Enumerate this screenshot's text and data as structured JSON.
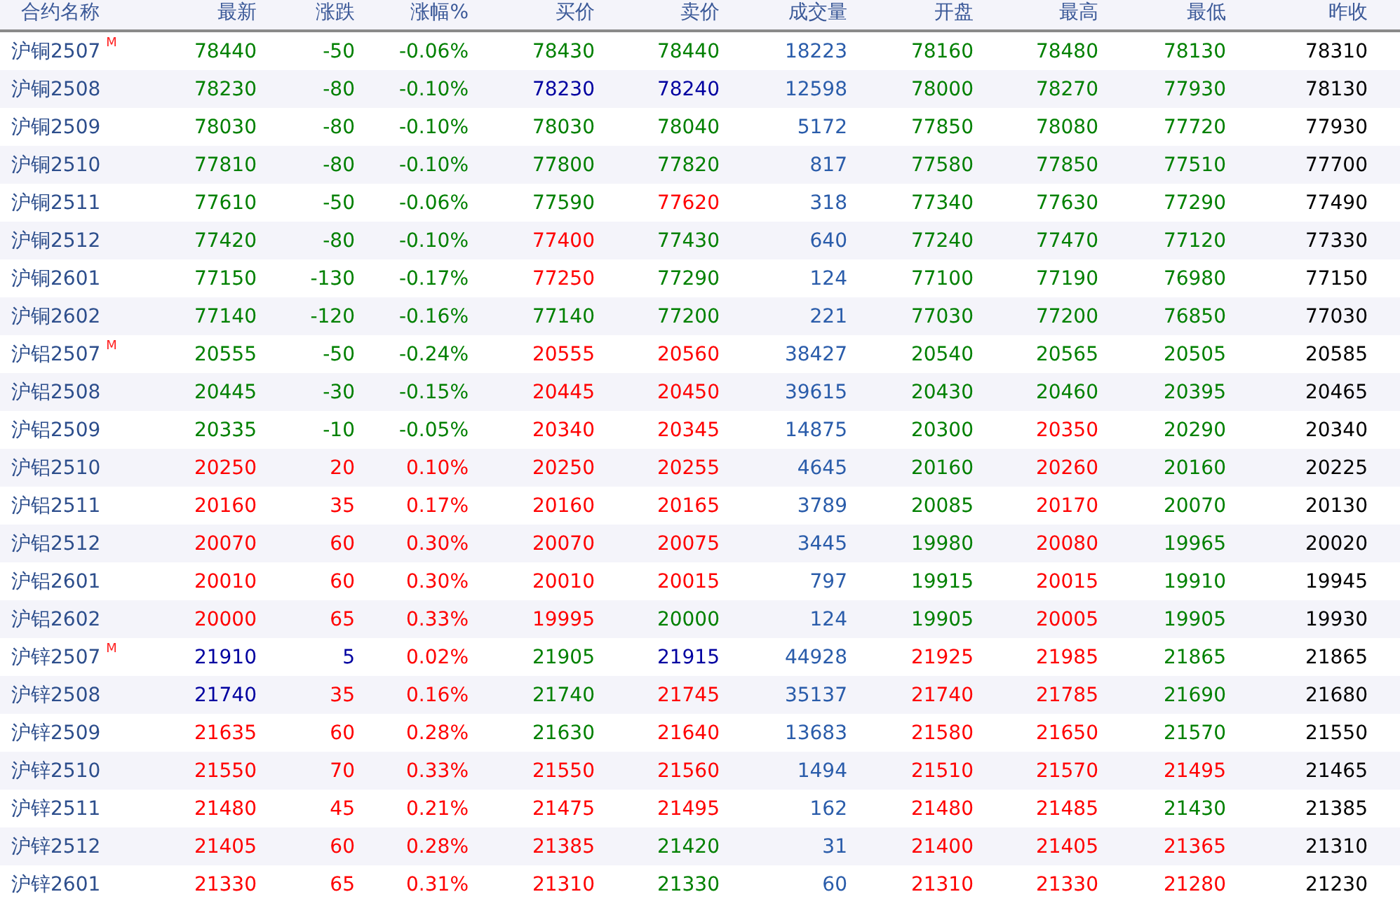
{
  "columns": [
    "合约名称",
    "最新",
    "涨跌",
    "涨幅%",
    "买价",
    "卖价",
    "成交量",
    "开盘",
    "最高",
    "最低",
    "昨收"
  ],
  "rows": [
    {
      "name": "沪铜2507",
      "badge": "M",
      "cells": [
        {
          "text": "78440",
          "color": "#008000"
        },
        {
          "text": "-50",
          "color": "#008000"
        },
        {
          "text": "-0.06%",
          "color": "#008000"
        },
        {
          "text": "78430",
          "color": "#008000"
        },
        {
          "text": "78440",
          "color": "#008000"
        },
        {
          "text": "18223",
          "color": "#2a5caa"
        },
        {
          "text": "78160",
          "color": "#008000"
        },
        {
          "text": "78480",
          "color": "#008000"
        },
        {
          "text": "78130",
          "color": "#008000"
        },
        {
          "text": "78310",
          "color": "#000000"
        }
      ]
    },
    {
      "name": "沪铜2508",
      "cells": [
        {
          "text": "78230",
          "color": "#008000"
        },
        {
          "text": "-80",
          "color": "#008000"
        },
        {
          "text": "-0.10%",
          "color": "#008000"
        },
        {
          "text": "78230",
          "color": "#0000a0"
        },
        {
          "text": "78240",
          "color": "#0000a0"
        },
        {
          "text": "12598",
          "color": "#2a5caa"
        },
        {
          "text": "78000",
          "color": "#008000"
        },
        {
          "text": "78270",
          "color": "#008000"
        },
        {
          "text": "77930",
          "color": "#008000"
        },
        {
          "text": "78130",
          "color": "#000000"
        }
      ]
    },
    {
      "name": "沪铜2509",
      "cells": [
        {
          "text": "78030",
          "color": "#008000"
        },
        {
          "text": "-80",
          "color": "#008000"
        },
        {
          "text": "-0.10%",
          "color": "#008000"
        },
        {
          "text": "78030",
          "color": "#008000"
        },
        {
          "text": "78040",
          "color": "#008000"
        },
        {
          "text": "5172",
          "color": "#2a5caa"
        },
        {
          "text": "77850",
          "color": "#008000"
        },
        {
          "text": "78080",
          "color": "#008000"
        },
        {
          "text": "77720",
          "color": "#008000"
        },
        {
          "text": "77930",
          "color": "#000000"
        }
      ]
    },
    {
      "name": "沪铜2510",
      "cells": [
        {
          "text": "77810",
          "color": "#008000"
        },
        {
          "text": "-80",
          "color": "#008000"
        },
        {
          "text": "-0.10%",
          "color": "#008000"
        },
        {
          "text": "77800",
          "color": "#008000"
        },
        {
          "text": "77820",
          "color": "#008000"
        },
        {
          "text": "817",
          "color": "#2a5caa"
        },
        {
          "text": "77580",
          "color": "#008000"
        },
        {
          "text": "77850",
          "color": "#008000"
        },
        {
          "text": "77510",
          "color": "#008000"
        },
        {
          "text": "77700",
          "color": "#000000"
        }
      ]
    },
    {
      "name": "沪铜2511",
      "cells": [
        {
          "text": "77610",
          "color": "#008000"
        },
        {
          "text": "-50",
          "color": "#008000"
        },
        {
          "text": "-0.06%",
          "color": "#008000"
        },
        {
          "text": "77590",
          "color": "#008000"
        },
        {
          "text": "77620",
          "color": "#ff0000"
        },
        {
          "text": "318",
          "color": "#2a5caa"
        },
        {
          "text": "77340",
          "color": "#008000"
        },
        {
          "text": "77630",
          "color": "#008000"
        },
        {
          "text": "77290",
          "color": "#008000"
        },
        {
          "text": "77490",
          "color": "#000000"
        }
      ]
    },
    {
      "name": "沪铜2512",
      "cells": [
        {
          "text": "77420",
          "color": "#008000"
        },
        {
          "text": "-80",
          "color": "#008000"
        },
        {
          "text": "-0.10%",
          "color": "#008000"
        },
        {
          "text": "77400",
          "color": "#ff0000"
        },
        {
          "text": "77430",
          "color": "#008000"
        },
        {
          "text": "640",
          "color": "#2a5caa"
        },
        {
          "text": "77240",
          "color": "#008000"
        },
        {
          "text": "77470",
          "color": "#008000"
        },
        {
          "text": "77120",
          "color": "#008000"
        },
        {
          "text": "77330",
          "color": "#000000"
        }
      ]
    },
    {
      "name": "沪铜2601",
      "cells": [
        {
          "text": "77150",
          "color": "#008000"
        },
        {
          "text": "-130",
          "color": "#008000"
        },
        {
          "text": "-0.17%",
          "color": "#008000"
        },
        {
          "text": "77250",
          "color": "#ff0000"
        },
        {
          "text": "77290",
          "color": "#008000"
        },
        {
          "text": "124",
          "color": "#2a5caa"
        },
        {
          "text": "77100",
          "color": "#008000"
        },
        {
          "text": "77190",
          "color": "#008000"
        },
        {
          "text": "76980",
          "color": "#008000"
        },
        {
          "text": "77150",
          "color": "#000000"
        }
      ]
    },
    {
      "name": "沪铜2602",
      "cells": [
        {
          "text": "77140",
          "color": "#008000"
        },
        {
          "text": "-120",
          "color": "#008000"
        },
        {
          "text": "-0.16%",
          "color": "#008000"
        },
        {
          "text": "77140",
          "color": "#008000"
        },
        {
          "text": "77200",
          "color": "#008000"
        },
        {
          "text": "221",
          "color": "#2a5caa"
        },
        {
          "text": "77030",
          "color": "#008000"
        },
        {
          "text": "77200",
          "color": "#008000"
        },
        {
          "text": "76850",
          "color": "#008000"
        },
        {
          "text": "77030",
          "color": "#000000"
        }
      ]
    },
    {
      "name": "沪铝2507",
      "badge": "M",
      "cells": [
        {
          "text": "20555",
          "color": "#008000"
        },
        {
          "text": "-50",
          "color": "#008000"
        },
        {
          "text": "-0.24%",
          "color": "#008000"
        },
        {
          "text": "20555",
          "color": "#ff0000"
        },
        {
          "text": "20560",
          "color": "#ff0000"
        },
        {
          "text": "38427",
          "color": "#2a5caa"
        },
        {
          "text": "20540",
          "color": "#008000"
        },
        {
          "text": "20565",
          "color": "#008000"
        },
        {
          "text": "20505",
          "color": "#008000"
        },
        {
          "text": "20585",
          "color": "#000000"
        }
      ]
    },
    {
      "name": "沪铝2508",
      "cells": [
        {
          "text": "20445",
          "color": "#008000"
        },
        {
          "text": "-30",
          "color": "#008000"
        },
        {
          "text": "-0.15%",
          "color": "#008000"
        },
        {
          "text": "20445",
          "color": "#ff0000"
        },
        {
          "text": "20450",
          "color": "#ff0000"
        },
        {
          "text": "39615",
          "color": "#2a5caa"
        },
        {
          "text": "20430",
          "color": "#008000"
        },
        {
          "text": "20460",
          "color": "#008000"
        },
        {
          "text": "20395",
          "color": "#008000"
        },
        {
          "text": "20465",
          "color": "#000000"
        }
      ]
    },
    {
      "name": "沪铝2509",
      "cells": [
        {
          "text": "20335",
          "color": "#008000"
        },
        {
          "text": "-10",
          "color": "#008000"
        },
        {
          "text": "-0.05%",
          "color": "#008000"
        },
        {
          "text": "20340",
          "color": "#ff0000"
        },
        {
          "text": "20345",
          "color": "#ff0000"
        },
        {
          "text": "14875",
          "color": "#2a5caa"
        },
        {
          "text": "20300",
          "color": "#008000"
        },
        {
          "text": "20350",
          "color": "#ff0000"
        },
        {
          "text": "20290",
          "color": "#008000"
        },
        {
          "text": "20340",
          "color": "#000000"
        }
      ]
    },
    {
      "name": "沪铝2510",
      "cells": [
        {
          "text": "20250",
          "color": "#ff0000"
        },
        {
          "text": "20",
          "color": "#ff0000"
        },
        {
          "text": "0.10%",
          "color": "#ff0000"
        },
        {
          "text": "20250",
          "color": "#ff0000"
        },
        {
          "text": "20255",
          "color": "#ff0000"
        },
        {
          "text": "4645",
          "color": "#2a5caa"
        },
        {
          "text": "20160",
          "color": "#008000"
        },
        {
          "text": "20260",
          "color": "#ff0000"
        },
        {
          "text": "20160",
          "color": "#008000"
        },
        {
          "text": "20225",
          "color": "#000000"
        }
      ]
    },
    {
      "name": "沪铝2511",
      "cells": [
        {
          "text": "20160",
          "color": "#ff0000"
        },
        {
          "text": "35",
          "color": "#ff0000"
        },
        {
          "text": "0.17%",
          "color": "#ff0000"
        },
        {
          "text": "20160",
          "color": "#ff0000"
        },
        {
          "text": "20165",
          "color": "#ff0000"
        },
        {
          "text": "3789",
          "color": "#2a5caa"
        },
        {
          "text": "20085",
          "color": "#008000"
        },
        {
          "text": "20170",
          "color": "#ff0000"
        },
        {
          "text": "20070",
          "color": "#008000"
        },
        {
          "text": "20130",
          "color": "#000000"
        }
      ]
    },
    {
      "name": "沪铝2512",
      "cells": [
        {
          "text": "20070",
          "color": "#ff0000"
        },
        {
          "text": "60",
          "color": "#ff0000"
        },
        {
          "text": "0.30%",
          "color": "#ff0000"
        },
        {
          "text": "20070",
          "color": "#ff0000"
        },
        {
          "text": "20075",
          "color": "#ff0000"
        },
        {
          "text": "3445",
          "color": "#2a5caa"
        },
        {
          "text": "19980",
          "color": "#008000"
        },
        {
          "text": "20080",
          "color": "#ff0000"
        },
        {
          "text": "19965",
          "color": "#008000"
        },
        {
          "text": "20020",
          "color": "#000000"
        }
      ]
    },
    {
      "name": "沪铝2601",
      "cells": [
        {
          "text": "20010",
          "color": "#ff0000"
        },
        {
          "text": "60",
          "color": "#ff0000"
        },
        {
          "text": "0.30%",
          "color": "#ff0000"
        },
        {
          "text": "20010",
          "color": "#ff0000"
        },
        {
          "text": "20015",
          "color": "#ff0000"
        },
        {
          "text": "797",
          "color": "#2a5caa"
        },
        {
          "text": "19915",
          "color": "#008000"
        },
        {
          "text": "20015",
          "color": "#ff0000"
        },
        {
          "text": "19910",
          "color": "#008000"
        },
        {
          "text": "19945",
          "color": "#000000"
        }
      ]
    },
    {
      "name": "沪铝2602",
      "cells": [
        {
          "text": "20000",
          "color": "#ff0000"
        },
        {
          "text": "65",
          "color": "#ff0000"
        },
        {
          "text": "0.33%",
          "color": "#ff0000"
        },
        {
          "text": "19995",
          "color": "#ff0000"
        },
        {
          "text": "20000",
          "color": "#008000"
        },
        {
          "text": "124",
          "color": "#2a5caa"
        },
        {
          "text": "19905",
          "color": "#008000"
        },
        {
          "text": "20005",
          "color": "#ff0000"
        },
        {
          "text": "19905",
          "color": "#008000"
        },
        {
          "text": "19930",
          "color": "#000000"
        }
      ]
    },
    {
      "name": "沪锌2507",
      "badge": "M",
      "cells": [
        {
          "text": "21910",
          "color": "#0000a0"
        },
        {
          "text": "5",
          "color": "#0000a0"
        },
        {
          "text": "0.02%",
          "color": "#ff0000"
        },
        {
          "text": "21905",
          "color": "#008000"
        },
        {
          "text": "21915",
          "color": "#0000a0"
        },
        {
          "text": "44928",
          "color": "#2a5caa"
        },
        {
          "text": "21925",
          "color": "#ff0000"
        },
        {
          "text": "21985",
          "color": "#ff0000"
        },
        {
          "text": "21865",
          "color": "#008000"
        },
        {
          "text": "21865",
          "color": "#000000"
        }
      ]
    },
    {
      "name": "沪锌2508",
      "cells": [
        {
          "text": "21740",
          "color": "#0000a0"
        },
        {
          "text": "35",
          "color": "#ff0000"
        },
        {
          "text": "0.16%",
          "color": "#ff0000"
        },
        {
          "text": "21740",
          "color": "#008000"
        },
        {
          "text": "21745",
          "color": "#ff0000"
        },
        {
          "text": "35137",
          "color": "#2a5caa"
        },
        {
          "text": "21740",
          "color": "#ff0000"
        },
        {
          "text": "21785",
          "color": "#ff0000"
        },
        {
          "text": "21690",
          "color": "#008000"
        },
        {
          "text": "21680",
          "color": "#000000"
        }
      ]
    },
    {
      "name": "沪锌2509",
      "cells": [
        {
          "text": "21635",
          "color": "#ff0000"
        },
        {
          "text": "60",
          "color": "#ff0000"
        },
        {
          "text": "0.28%",
          "color": "#ff0000"
        },
        {
          "text": "21630",
          "color": "#008000"
        },
        {
          "text": "21640",
          "color": "#ff0000"
        },
        {
          "text": "13683",
          "color": "#2a5caa"
        },
        {
          "text": "21580",
          "color": "#ff0000"
        },
        {
          "text": "21650",
          "color": "#ff0000"
        },
        {
          "text": "21570",
          "color": "#008000"
        },
        {
          "text": "21550",
          "color": "#000000"
        }
      ]
    },
    {
      "name": "沪锌2510",
      "cells": [
        {
          "text": "21550",
          "color": "#ff0000"
        },
        {
          "text": "70",
          "color": "#ff0000"
        },
        {
          "text": "0.33%",
          "color": "#ff0000"
        },
        {
          "text": "21550",
          "color": "#ff0000"
        },
        {
          "text": "21560",
          "color": "#ff0000"
        },
        {
          "text": "1494",
          "color": "#2a5caa"
        },
        {
          "text": "21510",
          "color": "#ff0000"
        },
        {
          "text": "21570",
          "color": "#ff0000"
        },
        {
          "text": "21495",
          "color": "#ff0000"
        },
        {
          "text": "21465",
          "color": "#000000"
        }
      ]
    },
    {
      "name": "沪锌2511",
      "cells": [
        {
          "text": "21480",
          "color": "#ff0000"
        },
        {
          "text": "45",
          "color": "#ff0000"
        },
        {
          "text": "0.21%",
          "color": "#ff0000"
        },
        {
          "text": "21475",
          "color": "#ff0000"
        },
        {
          "text": "21495",
          "color": "#ff0000"
        },
        {
          "text": "162",
          "color": "#2a5caa"
        },
        {
          "text": "21480",
          "color": "#ff0000"
        },
        {
          "text": "21485",
          "color": "#ff0000"
        },
        {
          "text": "21430",
          "color": "#008000"
        },
        {
          "text": "21385",
          "color": "#000000"
        }
      ]
    },
    {
      "name": "沪锌2512",
      "cells": [
        {
          "text": "21405",
          "color": "#ff0000"
        },
        {
          "text": "60",
          "color": "#ff0000"
        },
        {
          "text": "0.28%",
          "color": "#ff0000"
        },
        {
          "text": "21385",
          "color": "#ff0000"
        },
        {
          "text": "21420",
          "color": "#008000"
        },
        {
          "text": "31",
          "color": "#2a5caa"
        },
        {
          "text": "21400",
          "color": "#ff0000"
        },
        {
          "text": "21405",
          "color": "#ff0000"
        },
        {
          "text": "21365",
          "color": "#ff0000"
        },
        {
          "text": "21310",
          "color": "#000000"
        }
      ]
    },
    {
      "name": "沪锌2601",
      "cells": [
        {
          "text": "21330",
          "color": "#ff0000"
        },
        {
          "text": "65",
          "color": "#ff0000"
        },
        {
          "text": "0.31%",
          "color": "#ff0000"
        },
        {
          "text": "21310",
          "color": "#ff0000"
        },
        {
          "text": "21330",
          "color": "#008000"
        },
        {
          "text": "60",
          "color": "#2a5caa"
        },
        {
          "text": "21310",
          "color": "#ff0000"
        },
        {
          "text": "21330",
          "color": "#ff0000"
        },
        {
          "text": "21280",
          "color": "#ff0000"
        },
        {
          "text": "21230",
          "color": "#000000"
        }
      ]
    }
  ]
}
